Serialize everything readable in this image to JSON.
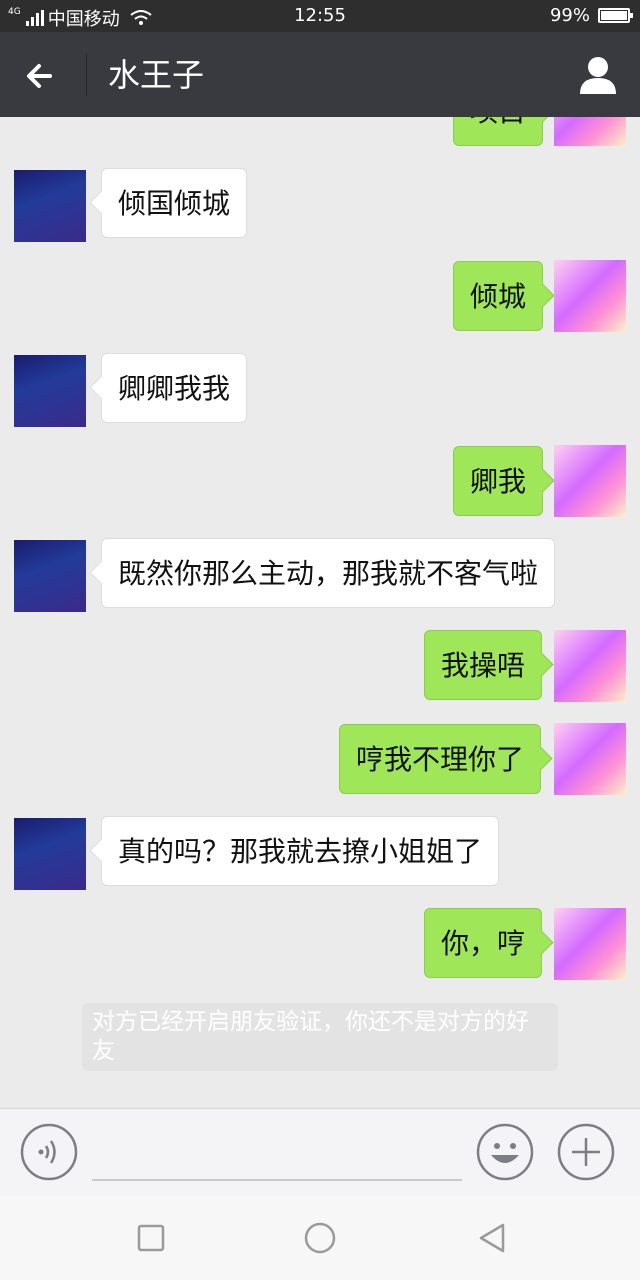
{
  "status_bar": {
    "network": "4G",
    "carrier": "中国移动",
    "time": "12:55",
    "battery": "99%",
    "battery_level": 0.99
  },
  "header": {
    "title": "水王子"
  },
  "messages": [
    {
      "side": "right",
      "text": "项目",
      "avatar": "princess-avatar"
    },
    {
      "side": "left",
      "text": "倾国倾城",
      "avatar": "prince-avatar"
    },
    {
      "side": "right",
      "text": "倾城",
      "avatar": "princess-avatar"
    },
    {
      "side": "left",
      "text": "卿卿我我",
      "avatar": "prince-avatar"
    },
    {
      "side": "right",
      "text": "卿我",
      "avatar": "princess-avatar"
    },
    {
      "side": "left",
      "text": "既然你那么主动，那我就不客气啦",
      "avatar": "prince-avatar"
    },
    {
      "side": "right",
      "text": "我操唔",
      "avatar": "princess-avatar"
    },
    {
      "side": "right",
      "text": "哼我不理你了",
      "avatar": "princess-avatar"
    },
    {
      "side": "left",
      "text": "真的吗？那我就去撩小姐姐了",
      "avatar": "prince-avatar"
    },
    {
      "side": "right",
      "text": "你，哼",
      "avatar": "princess-avatar"
    }
  ],
  "system_notice": "对方已经开启朋友验证，你还不是对方的好友",
  "input_bar": {
    "text_value": "",
    "voice_icon": "voice-icon",
    "emoji_icon": "emoji-icon",
    "plus_icon": "plus-icon"
  },
  "colors": {
    "header_bg": "#393a3f",
    "chat_bg": "#ebebeb",
    "bubble_sent": "#9fe658",
    "bubble_received": "#ffffff"
  }
}
